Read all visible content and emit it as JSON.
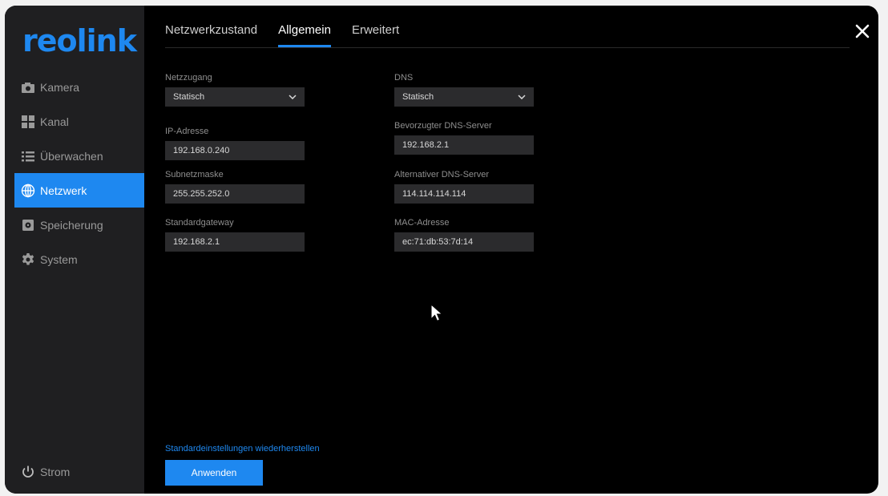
{
  "brand": {
    "logo_text": "reolink",
    "accent": "#1e88f0"
  },
  "sidebar": {
    "items": [
      {
        "label": "Kamera",
        "icon": "camera-icon",
        "active": false
      },
      {
        "label": "Kanal",
        "icon": "grid-icon",
        "active": false
      },
      {
        "label": "Überwachen",
        "icon": "list-icon",
        "active": false
      },
      {
        "label": "Netzwerk",
        "icon": "globe-icon",
        "active": true
      },
      {
        "label": "Speicherung",
        "icon": "storage-icon",
        "active": false
      },
      {
        "label": "System",
        "icon": "gear-icon",
        "active": false
      }
    ],
    "power_label": "Strom"
  },
  "tabs": [
    {
      "label": "Netzwerkzustand",
      "active": false
    },
    {
      "label": "Allgemein",
      "active": true
    },
    {
      "label": "Erweitert",
      "active": false
    }
  ],
  "left": {
    "access": {
      "label": "Netzzugang",
      "value": "Statisch"
    },
    "ip": {
      "label": "IP-Adresse",
      "value": "192.168.0.240"
    },
    "subnet": {
      "label": "Subnetzmaske",
      "value": "255.255.252.0"
    },
    "gateway": {
      "label": "Standardgateway",
      "value": "192.168.2.1"
    }
  },
  "right": {
    "dns": {
      "label": "DNS",
      "value": "Statisch"
    },
    "dns1": {
      "label": "Bevorzugter DNS-Server",
      "value": "192.168.2.1"
    },
    "dns2": {
      "label": "Alternativer DNS-Server",
      "value": "114.114.114.114"
    },
    "mac": {
      "label": "MAC-Adresse",
      "value": "ec:71:db:53:7d:14"
    }
  },
  "actions": {
    "reset_label": "Standardeinstellungen wiederherstellen",
    "apply_label": "Anwenden"
  }
}
